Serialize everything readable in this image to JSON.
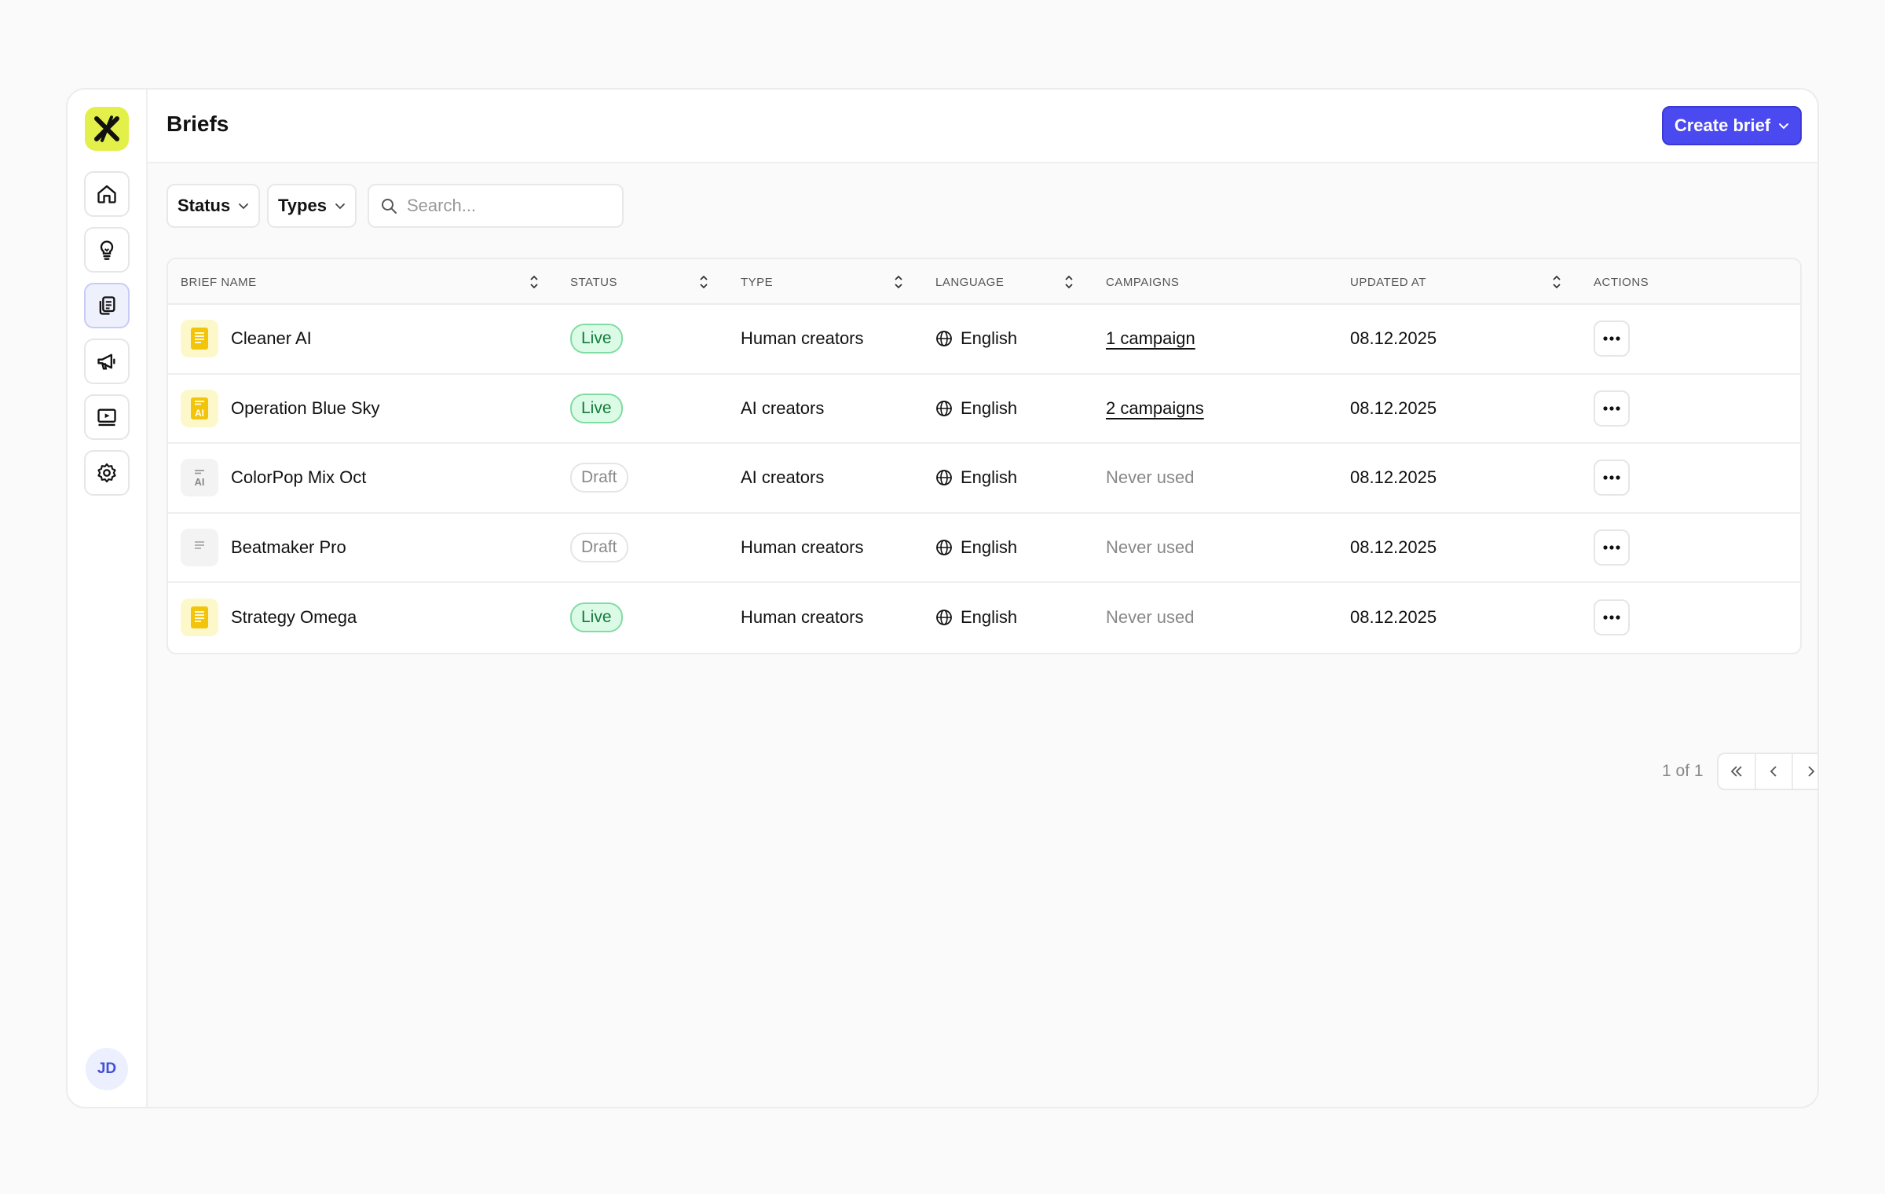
{
  "header": {
    "title": "Briefs",
    "create_label": "Create brief"
  },
  "sidebar": {
    "items": [
      {
        "name": "home"
      },
      {
        "name": "ideas"
      },
      {
        "name": "briefs",
        "active": true
      },
      {
        "name": "campaigns"
      },
      {
        "name": "videos"
      },
      {
        "name": "settings"
      }
    ],
    "avatar_initials": "JD"
  },
  "filters": {
    "status_label": "Status",
    "types_label": "Types",
    "search_placeholder": "Search..."
  },
  "table": {
    "columns": [
      "BRIEF NAME",
      "STATUS",
      "TYPE",
      "LANGUAGE",
      "CAMPAIGNS",
      "UPDATED AT",
      "ACTIONS"
    ],
    "rows": [
      {
        "name": "Cleaner AI",
        "icon": "doc-yellow",
        "status": "Live",
        "type": "Human creators",
        "language": "English",
        "campaigns": "1 campaign",
        "campaigns_linked": true,
        "updated": "08.12.2025"
      },
      {
        "name": "Operation Blue Sky",
        "icon": "ai-yellow",
        "status": "Live",
        "type": "AI creators",
        "language": "English",
        "campaigns": "2 campaigns",
        "campaigns_linked": true,
        "updated": "08.12.2025"
      },
      {
        "name": "ColorPop Mix Oct",
        "icon": "ai-grey",
        "status": "Draft",
        "type": "AI creators",
        "language": "English",
        "campaigns": "Never used",
        "campaigns_linked": false,
        "updated": "08.12.2025"
      },
      {
        "name": "Beatmaker Pro",
        "icon": "doc-grey",
        "status": "Draft",
        "type": "Human creators",
        "language": "English",
        "campaigns": "Never used",
        "campaigns_linked": false,
        "updated": "08.12.2025"
      },
      {
        "name": "Strategy Omega",
        "icon": "doc-yellow",
        "status": "Live",
        "type": "Human creators",
        "language": "English",
        "campaigns": "Never used",
        "campaigns_linked": false,
        "updated": "08.12.2025"
      }
    ]
  },
  "pagination": {
    "label": "1 of 1"
  },
  "colors": {
    "accent": "#4b4af0",
    "brand": "#e3f04a",
    "live_bg": "#dcfbe6",
    "live_text": "#137a3c"
  }
}
